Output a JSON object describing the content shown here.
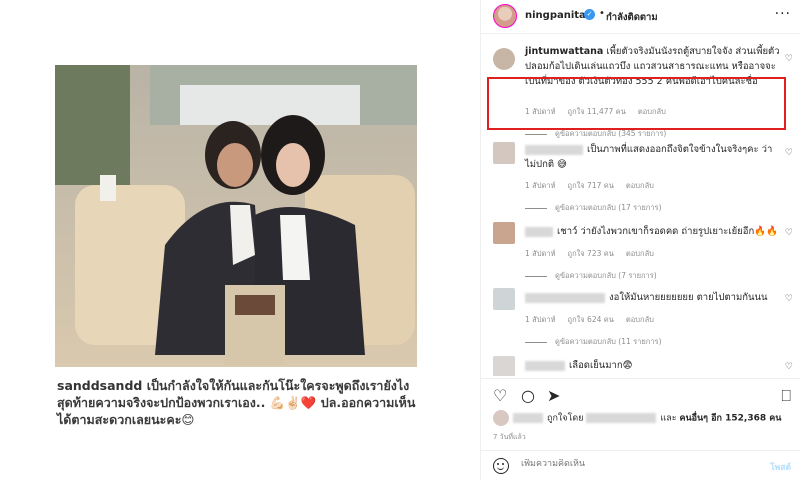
{
  "post": {
    "caption_line1_user": "sanddsandd",
    "caption_line1": " เป็นกำลังใจให้กันและกันโน๊ะใครจะพูดถึงเรายังไง",
    "caption_line2": "สุดท้ายความจริงจะปกป้องพวกเราเอง.. 💪🏻✌🏻❤️ ปล.ออกความเห็น",
    "caption_line3": "ได้ตามสะดวกเลยนะคะ😊"
  },
  "header": {
    "username": "ningpanita",
    "verified_mark": "✓",
    "separator": "•",
    "follow_status": "กำลังติดตาม",
    "more": "···"
  },
  "comments": [
    {
      "username": "jintumwattana",
      "text": " เพี้ยตัวจริงมันนังรถตู้สบายใจจัง ส่วนเพี้ยตัวปลอมก้อไปเดินเล่นแถวบึง แถวสวนสาธารณะแทน หรืออาจจะเปนที่มาของ ตัวเงินตัวทอง 555 2 คนพอดีเอาไปคนละชื่อ",
      "time": "1 สัปดาห์",
      "likes": "ถูกใจ 11,477 คน",
      "reply": "ตอบกลับ",
      "replies": "ดูข้อความตอบกลับ (345 รายการ)"
    },
    {
      "text": "เป็นภาพที่แสดงออกถึงจิตใจข้างในจริงๆคะ ว่าไม่ปกติ 😅",
      "time": "1 สัปดาห์",
      "likes": "ถูกใจ 717 คน",
      "reply": "ตอบกลับ",
      "replies": "ดูข้อความตอบกลับ (17 รายการ)"
    },
    {
      "text": "เชาว์ ว่ายังไงพวกเขาก็รอดคด ถ่ายรูปเยาะเย้ยอีก🔥🔥",
      "time": "1 สัปดาห์",
      "likes": "ถูกใจ 723 คน",
      "reply": "ตอบกลับ",
      "replies": "ดูข้อความตอบกลับ (7 รายการ)"
    },
    {
      "text": "งอให้มันหายยยยยยย ตายไปตามกันนน",
      "time": "1 สัปดาห์",
      "likes": "ถูกใจ 624 คน",
      "reply": "ตอบกลับ",
      "replies": "ดูข้อความตอบกลับ (11 รายการ)"
    },
    {
      "text": "เลือดเย็นมาก😨"
    }
  ],
  "likes_line": {
    "prefix": "ถูกใจโดย",
    "middle": "และ",
    "others": "คนอื่นๆ อีก 152,368 คน"
  },
  "posted_time": "7 วันที่แล้ว",
  "add_comment": {
    "placeholder": "เพิ่มความคิดเห็น",
    "post_label": "โพสต์"
  },
  "icons": {
    "like": "heart-icon",
    "comment": "comment-icon",
    "share": "share-icon",
    "save": "bookmark-icon",
    "emoji": "emoji-icon"
  },
  "colors": {
    "highlight_border": "#e0201f",
    "verified": "#3897f0",
    "post_button": "#b2dffc"
  }
}
